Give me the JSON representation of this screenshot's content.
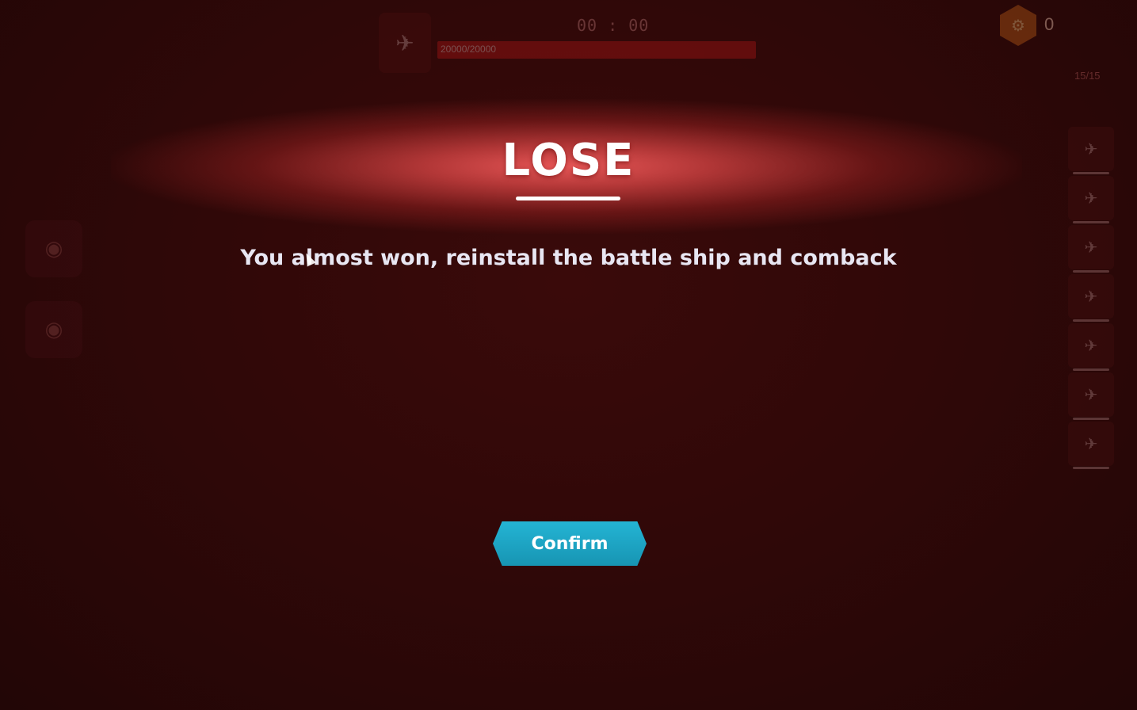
{
  "hud": {
    "boss_icon": "ship-icon",
    "boss_name": "",
    "timer": "00 : 00",
    "boss_hp": "20000/20000",
    "hp_fraction": 1.0,
    "currency_icon": "hexagon-gear-icon",
    "currency_value": "0",
    "wave_count": "15/15"
  },
  "skills": [
    {
      "icon": "skill-icon"
    },
    {
      "icon": "skill-icon"
    }
  ],
  "ships": [
    {
      "icon": "ship-icon"
    },
    {
      "icon": "ship-icon"
    },
    {
      "icon": "ship-icon"
    },
    {
      "icon": "ship-icon"
    },
    {
      "icon": "ship-icon"
    },
    {
      "icon": "ship-icon"
    },
    {
      "icon": "ship-icon"
    }
  ],
  "result": {
    "title": "LOSE",
    "message": "You almost won, reinstall the battle ship and comback",
    "confirm_label": "Confirm"
  },
  "colors": {
    "background": "#300808",
    "glow": "#e05050",
    "confirm_button": "#1ea6c6"
  }
}
